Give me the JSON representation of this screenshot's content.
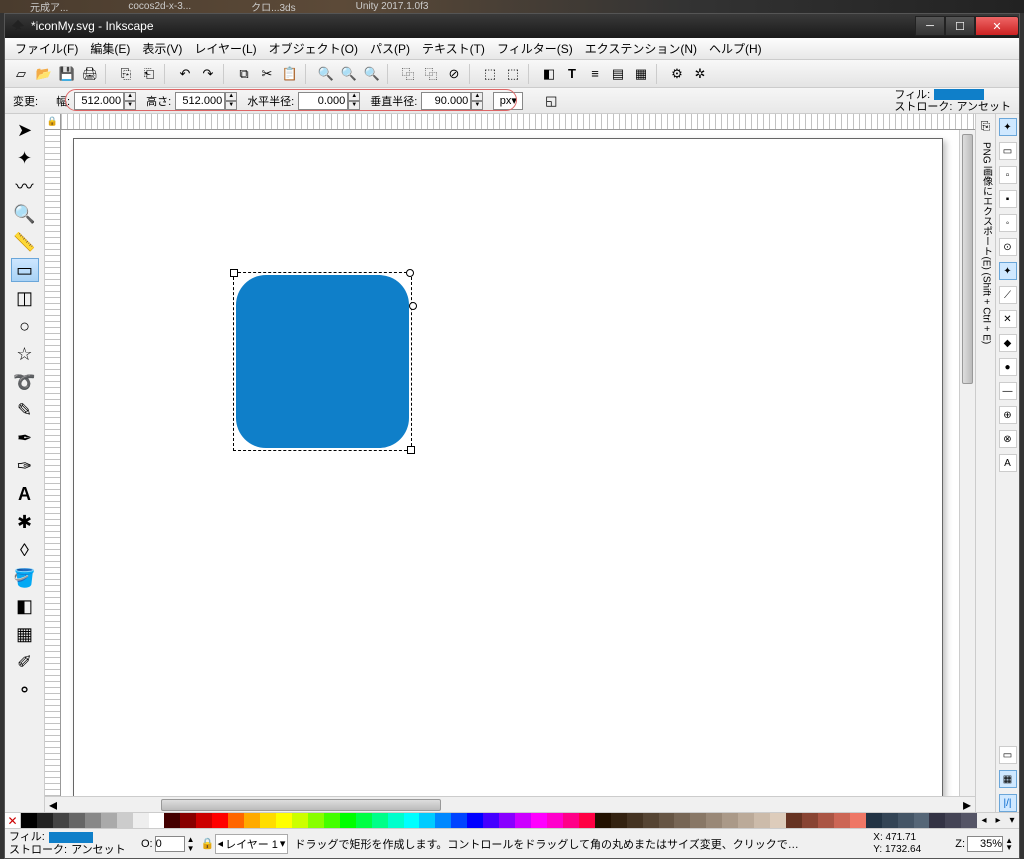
{
  "desktop_tabs": [
    "元成ア...",
    "cocos2d-x-3...",
    "クロ...3ds",
    "Unity 2017.1.0f3"
  ],
  "titlebar": {
    "title": "*iconMy.svg - Inkscape"
  },
  "menus": [
    "ファイル(F)",
    "編集(E)",
    "表示(V)",
    "レイヤー(L)",
    "オブジェクト(O)",
    "パス(P)",
    "テキスト(T)",
    "フィルター(S)",
    "エクステンション(N)",
    "ヘルプ(H)"
  ],
  "options": {
    "change_label": "変更:",
    "w_label": "幅:",
    "w": "512.000",
    "h_label": "高さ:",
    "h": "512.000",
    "rx_label": "水平半径:",
    "rx": "0.000",
    "ry_label": "垂直半径:",
    "ry": "90.000",
    "unit": "px",
    "fill_label": "フィル:",
    "stroke_label": "ストローク:",
    "stroke_value": "アンセット"
  },
  "rp_text": "PNG 画像にエクスポート(E) (Shift + Ctrl + E)",
  "palette": [
    "#000",
    "#222",
    "#444",
    "#666",
    "#888",
    "#aaa",
    "#ccc",
    "#eee",
    "#fff",
    "#400",
    "#800",
    "#c00",
    "#f00",
    "#f60",
    "#fa0",
    "#fd0",
    "#ff0",
    "#cf0",
    "#8f0",
    "#4f0",
    "#0f0",
    "#0f4",
    "#0f8",
    "#0fc",
    "#0ff",
    "#0cf",
    "#08f",
    "#04f",
    "#00f",
    "#40f",
    "#80f",
    "#c0f",
    "#f0f",
    "#f0c",
    "#f08",
    "#f04",
    "#210",
    "#321",
    "#432",
    "#543",
    "#654",
    "#765",
    "#876",
    "#987",
    "#a98",
    "#ba9",
    "#cba",
    "#dcb",
    "#632",
    "#843",
    "#a54",
    "#c65",
    "#e76",
    "#234",
    "#345",
    "#456",
    "#567",
    "#334",
    "#445",
    "#556"
  ],
  "status": {
    "fill_label": "フィル:",
    "stroke_label": "ストローク:",
    "stroke_value": "アンセット",
    "opacity_label": "O:",
    "opacity": "0",
    "layer": "レイヤー 1",
    "hint": "ドラッグで矩形を作成します。コントロールをドラッグして角の丸めまたはサイズ変更、クリックで…",
    "x_label": "X:",
    "x": "471.71",
    "y_label": "Y:",
    "y": "1732.64",
    "z_label": "Z:",
    "zoom": "35%"
  }
}
